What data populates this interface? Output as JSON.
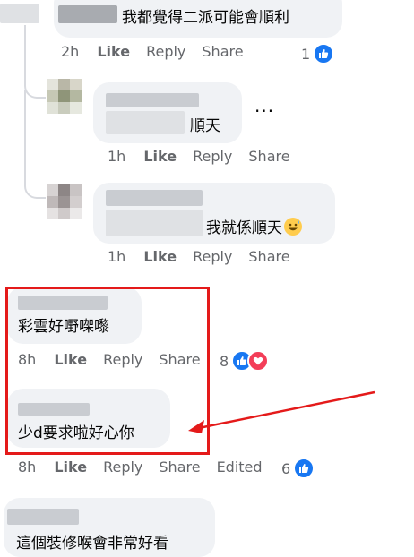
{
  "comments": [
    {
      "text": "我都覺得二派可能會順利",
      "time": "2h",
      "actions": [
        "Like",
        "Reply",
        "Share"
      ],
      "reaction_count": "1",
      "reactions": [
        "like-icon"
      ]
    },
    {
      "text": "順天",
      "time": "1h",
      "actions": [
        "Like",
        "Reply",
        "Share"
      ],
      "more_label": "···"
    },
    {
      "text": "我就係順天",
      "time": "1h",
      "actions": [
        "Like",
        "Reply",
        "Share"
      ],
      "emoji": "grinning-sweat-emoji"
    },
    {
      "text": "彩雲好嘢㗎嚟",
      "time": "8h",
      "actions": [
        "Like",
        "Reply",
        "Share"
      ],
      "reaction_count": "8",
      "reactions": [
        "like-icon",
        "love-icon"
      ]
    },
    {
      "text": "少d要求啦好心你",
      "time": "8h",
      "actions": [
        "Like",
        "Reply",
        "Share",
        "Edited"
      ],
      "reaction_count": "6",
      "reactions": [
        "like-icon"
      ]
    },
    {
      "text": "這個裝修喉會非常好看"
    }
  ],
  "colors": {
    "bubble": "#f0f2f5",
    "meta_text": "#65676b",
    "like_blue": "#1877f2",
    "love_red": "#f33e58",
    "annotation_red": "#e41a1a"
  }
}
